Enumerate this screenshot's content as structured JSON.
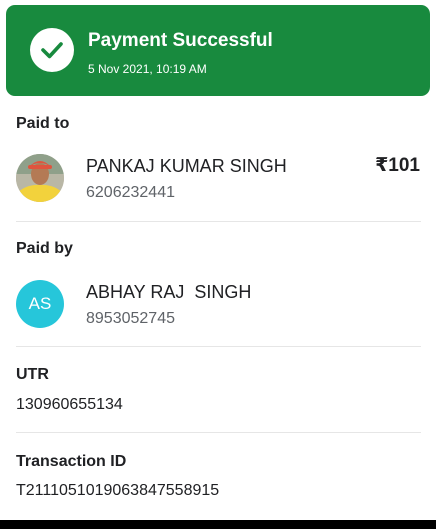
{
  "status": {
    "title": "Payment Successful",
    "timestamp": "5 Nov 2021, 10:19 AM",
    "icon": "check-circle-icon",
    "color": "#188a3e"
  },
  "paid_to": {
    "label": "Paid to",
    "name": "PANKAJ KUMAR SINGH",
    "phone": "6206232441",
    "amount": "₹101"
  },
  "paid_by": {
    "label": "Paid by",
    "initials": "AS",
    "name": "ABHAY RAJ  SINGH",
    "phone": "8953052745",
    "avatar_color": "#26c6da"
  },
  "utr": {
    "label": "UTR",
    "value": "130960655134"
  },
  "transaction": {
    "label": "Transaction ID",
    "value": "T2111051019063847558915"
  }
}
